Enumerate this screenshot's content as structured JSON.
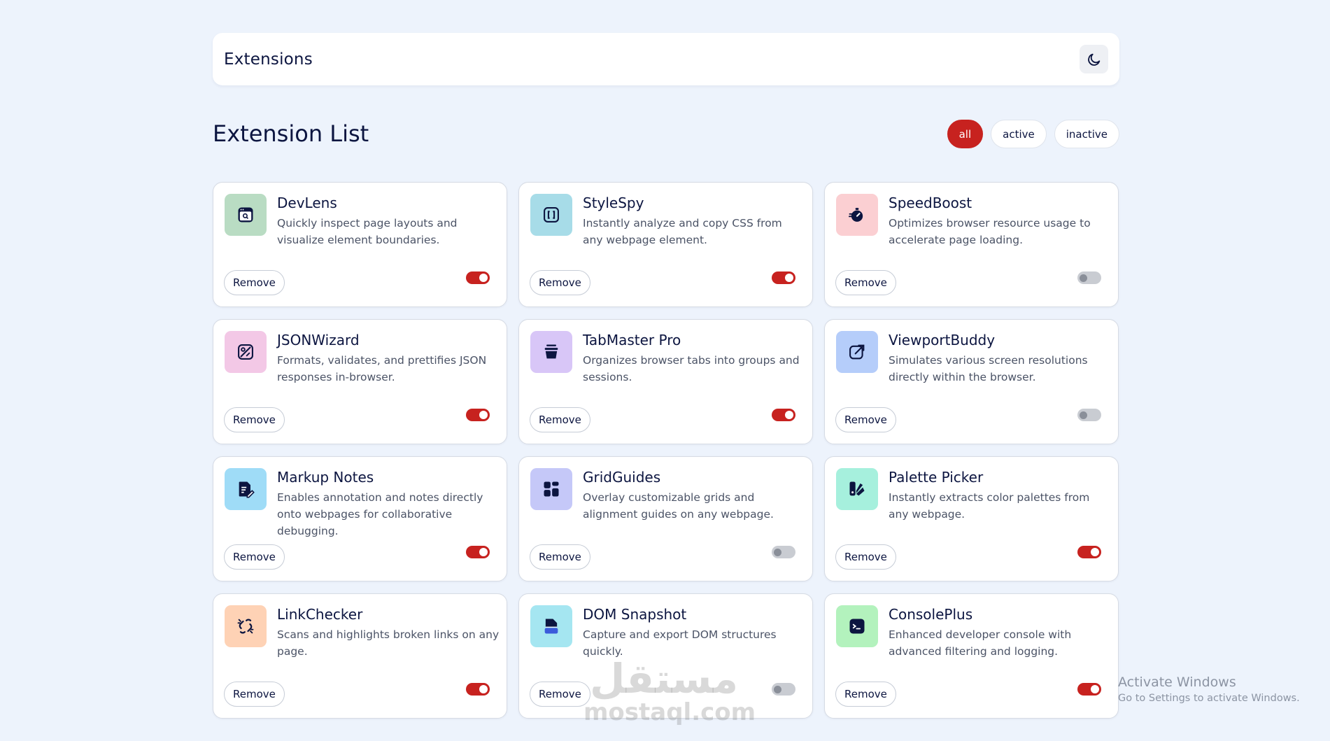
{
  "header": {
    "title": "Extensions",
    "theme_icon": "moon-icon"
  },
  "list": {
    "title": "Extension List"
  },
  "filters": [
    {
      "label": "all",
      "active": true
    },
    {
      "label": "active",
      "active": false
    },
    {
      "label": "inactive",
      "active": false
    }
  ],
  "extensions": [
    {
      "name": "DevLens",
      "description": "Quickly inspect page layouts and visualize element boundaries.",
      "enabled": true,
      "icon": "browser-search-icon",
      "icon_bg": "#b9dcc3",
      "remove_label": "Remove"
    },
    {
      "name": "StyleSpy",
      "description": "Instantly analyze and copy CSS from any webpage element.",
      "enabled": true,
      "icon": "code-brackets-icon",
      "icon_bg": "#a7dce8",
      "remove_label": "Remove"
    },
    {
      "name": "SpeedBoost",
      "description": "Optimizes browser resource usage to accelerate page loading.",
      "enabled": false,
      "icon": "stopwatch-icon",
      "icon_bg": "#fbcfd2",
      "remove_label": "Remove"
    },
    {
      "name": "JSONWizard",
      "description": "Formats, validates, and prettifies JSON responses in-browser.",
      "enabled": true,
      "icon": "magic-image-icon",
      "icon_bg": "#f3c8e6",
      "remove_label": "Remove"
    },
    {
      "name": "TabMaster Pro",
      "description": "Organizes browser tabs into groups and sessions.",
      "enabled": true,
      "icon": "box-stack-icon",
      "icon_bg": "#d8c6f7",
      "remove_label": "Remove"
    },
    {
      "name": "ViewportBuddy",
      "description": "Simulates various screen resolutions directly within the browser.",
      "enabled": false,
      "icon": "external-arrow-icon",
      "icon_bg": "#b5cdfa",
      "remove_label": "Remove"
    },
    {
      "name": "Markup Notes",
      "description": "Enables annotation and notes directly onto webpages for collaborative debugging.",
      "enabled": true,
      "icon": "document-pen-icon",
      "icon_bg": "#9fdcf7",
      "remove_label": "Remove"
    },
    {
      "name": "GridGuides",
      "description": "Overlay customizable grids and alignment guides on any webpage.",
      "enabled": false,
      "icon": "grid-icon",
      "icon_bg": "#c5c8f8",
      "remove_label": "Remove"
    },
    {
      "name": "Palette Picker",
      "description": "Instantly extracts color palettes from any webpage.",
      "enabled": true,
      "icon": "palette-icon",
      "icon_bg": "#a6f0dd",
      "remove_label": "Remove"
    },
    {
      "name": "LinkChecker",
      "description": "Scans and highlights broken links on any page.",
      "enabled": true,
      "icon": "broken-link-icon",
      "icon_bg": "#fed2b5",
      "remove_label": "Remove"
    },
    {
      "name": "DOM Snapshot",
      "description": "Capture and export DOM structures quickly.",
      "enabled": false,
      "icon": "snapshot-icon",
      "icon_bg": "#a5e6f1",
      "remove_label": "Remove"
    },
    {
      "name": "ConsolePlus",
      "description": "Enhanced developer console with advanced filtering and logging.",
      "enabled": true,
      "icon": "terminal-icon",
      "icon_bg": "#b3f2bd",
      "remove_label": "Remove"
    }
  ],
  "watermark": {
    "title": "Activate Windows",
    "subtitle": "Go to Settings to activate Windows.",
    "site_ar": "مستقل",
    "site_en": "mostaql.com"
  },
  "colors": {
    "accent": "#c7221f",
    "page_bg": "#edf3fc",
    "text": "#0c1540"
  }
}
